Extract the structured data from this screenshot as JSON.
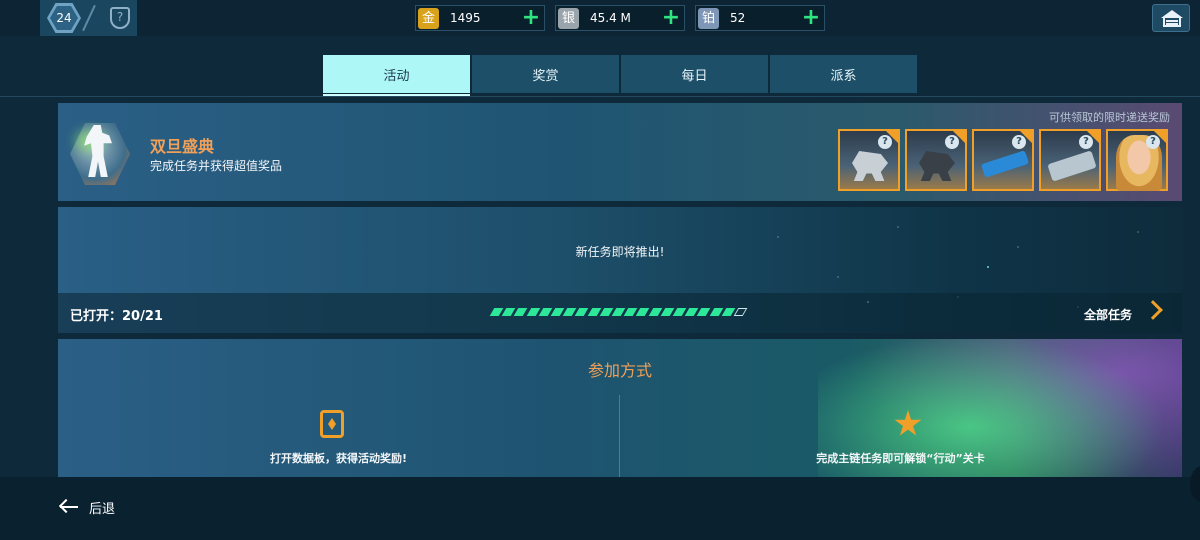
{
  "topbar": {
    "level": "24",
    "shield_label": "?",
    "currencies": [
      {
        "icon": "金",
        "name": "gold",
        "color": "#d9a21c",
        "value": "1495"
      },
      {
        "icon": "银",
        "name": "silver",
        "color": "#9aa4ac",
        "value": "45.4 M"
      },
      {
        "icon": "铂",
        "name": "platinum",
        "color": "#7f97b6",
        "value": "52"
      }
    ],
    "plus_label": "+"
  },
  "tabs": [
    {
      "label": "活动",
      "active": true
    },
    {
      "label": "奖赏",
      "active": false
    },
    {
      "label": "每日",
      "active": false
    },
    {
      "label": "派系",
      "active": false
    }
  ],
  "event": {
    "title": "双旦盛典",
    "subtitle": "完成任务并获得超值奖品",
    "reward_caption": "可供领取的限时递送奖励",
    "rewards": [
      {
        "kind": "robot"
      },
      {
        "kind": "robot-dark"
      },
      {
        "kind": "weapon"
      },
      {
        "kind": "weapon-silver"
      },
      {
        "kind": "pilot"
      }
    ],
    "unknown_mark": "?"
  },
  "progress": {
    "coming_soon": "新任务即将推出!",
    "opened_label": "已打开：",
    "opened_value": "20/21",
    "opened_count": 20,
    "total_count": 21,
    "all_tasks": "全部任务"
  },
  "join": {
    "title": "参加方式",
    "items": [
      {
        "icon": "datapad-icon",
        "text": "打开数据板，获得活动奖励!"
      },
      {
        "icon": "star-icon",
        "text": "完成主链任务即可解锁“行动”关卡"
      }
    ]
  },
  "footer": {
    "back_label": "后退"
  },
  "colors": {
    "accent_orange": "#f0a028",
    "progress_green": "#2ee89a",
    "active_tab": "#aef7f7",
    "plus_green": "#2ee57f"
  }
}
